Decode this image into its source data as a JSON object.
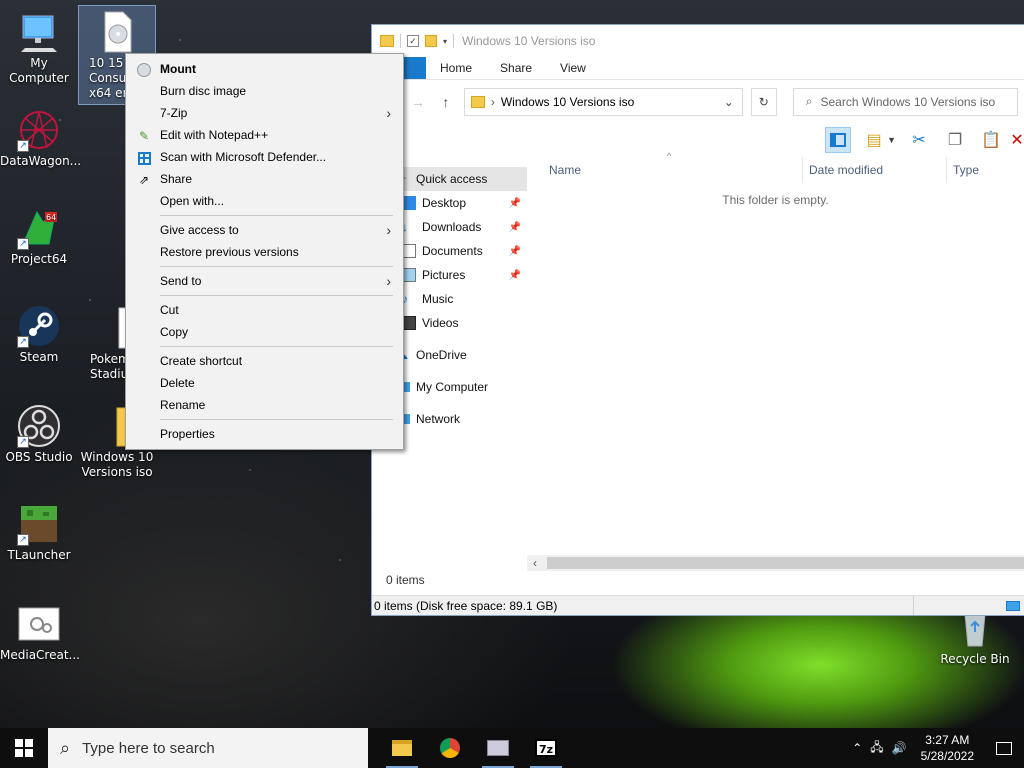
{
  "desktop": {
    "icons": [
      {
        "label": "My Computer"
      },
      {
        "label": "10 15\nConsu\nx64 en"
      },
      {
        "label": "DataWagon..."
      },
      {
        "label": "Project64"
      },
      {
        "label": "Steam"
      },
      {
        "label": "Pokem\nStadiu"
      },
      {
        "label": "OBS Studio"
      },
      {
        "label": "Windows 10\nVersions iso"
      },
      {
        "label": "TLauncher"
      },
      {
        "label": "MediaCreat..."
      },
      {
        "label": "Recycle Bin"
      }
    ]
  },
  "context_menu": {
    "items": [
      {
        "label": "Mount",
        "icon": "disc-icon"
      },
      {
        "label": "Burn disc image"
      },
      {
        "label": "7-Zip",
        "submenu": true
      },
      {
        "label": "Edit with Notepad++",
        "icon": "notepad-icon"
      },
      {
        "label": "Scan with Microsoft Defender...",
        "icon": "defender-icon"
      },
      {
        "label": "Share",
        "icon": "share-icon"
      },
      {
        "label": "Open with..."
      },
      {
        "label": "Give access to",
        "submenu": true
      },
      {
        "label": "Restore previous versions"
      },
      {
        "label": "Send to",
        "submenu": true
      },
      {
        "label": "Cut"
      },
      {
        "label": "Copy"
      },
      {
        "label": "Create shortcut"
      },
      {
        "label": "Delete"
      },
      {
        "label": "Rename"
      },
      {
        "label": "Properties"
      }
    ]
  },
  "explorer": {
    "title": "Windows 10 Versions iso",
    "ribbon_tabs": [
      "e",
      "Home",
      "Share",
      "View"
    ],
    "address": "Windows 10 Versions iso",
    "search_placeholder": "Search Windows 10 Versions iso",
    "nav": [
      {
        "label": "Quick access"
      },
      {
        "label": "Desktop"
      },
      {
        "label": "Downloads"
      },
      {
        "label": "Documents"
      },
      {
        "label": "Pictures"
      },
      {
        "label": "Music"
      },
      {
        "label": "Videos"
      },
      {
        "label": "OneDrive"
      },
      {
        "label": "My Computer"
      },
      {
        "label": "Network"
      }
    ],
    "columns": [
      "Name",
      "Date modified",
      "Type"
    ],
    "empty_message": "This folder is empty.",
    "item_count": "0 items",
    "status": "0 items (Disk free space: 89.1 GB)"
  },
  "taskbar": {
    "search_placeholder": "Type here to search",
    "time": "3:27 AM",
    "date": "5/28/2022",
    "accent_color": "#1979ca"
  }
}
